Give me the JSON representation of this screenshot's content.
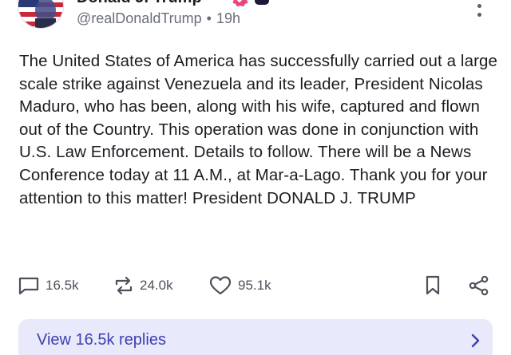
{
  "post": {
    "display_name": "Donald J. Trump",
    "handle": "@realDonaldTrump",
    "separator": "•",
    "time": "19h",
    "body": "The United States of America has successfully carried out a large scale strike against Venezuela and its leader, President Nicolas Maduro, who has been, along with his wife, captured and flown out of the Country. This operation was done in conjunction with U.S. Law Enforcement. Details to follow. There will be a News Conference today at 11 A.M., at Mar-a-Lago. Thank you for your attention to this matter! President DONALD J. TRUMP"
  },
  "actions": {
    "replies": "16.5k",
    "retruths": "24.0k",
    "likes": "95.1k"
  },
  "replies_button": {
    "label": "View 16.5k replies"
  },
  "icons": {
    "avatar": "avatar-flag-portrait",
    "verified": "verified-badge-icon",
    "more": "more-vertical-icon",
    "reply": "reply-icon",
    "retruth": "retruth-icon",
    "like": "heart-icon",
    "bookmark": "bookmark-icon",
    "share": "share-icon",
    "chevron": "chevron-right-icon"
  },
  "colors": {
    "accent": "#3d3fb0",
    "button_bg": "#e8e9fb",
    "muted_text": "#6a6e78",
    "verified_badge": "#e8457a"
  }
}
